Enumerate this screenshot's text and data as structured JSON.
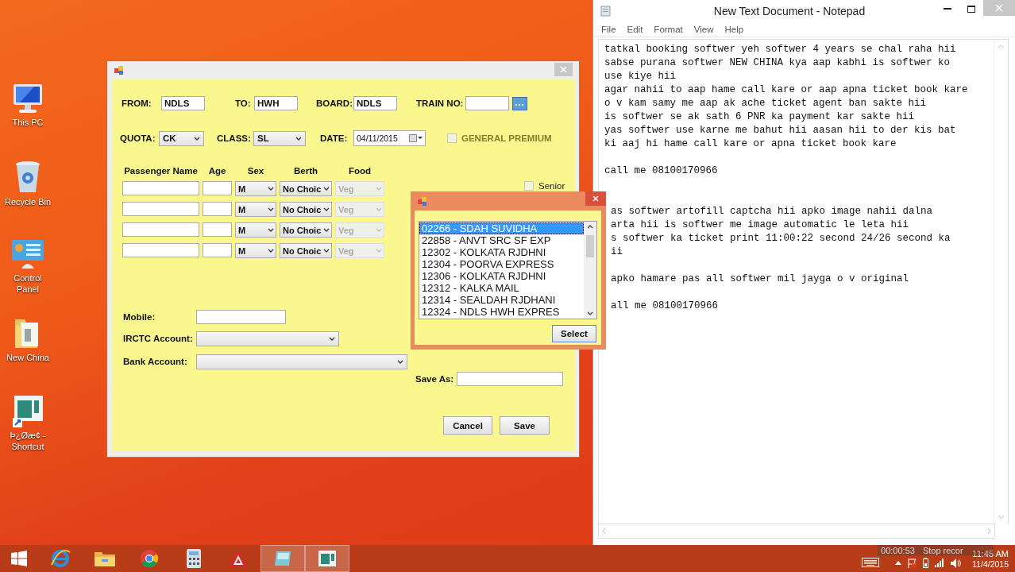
{
  "desktop_icons": [
    {
      "kind": "pc",
      "label": "This PC"
    },
    {
      "kind": "bin",
      "label": "Recycle Bin"
    },
    {
      "kind": "control",
      "label": "Control Panel"
    },
    {
      "kind": "folder",
      "label": "New China"
    },
    {
      "kind": "shortcut",
      "label": "Þ¿Øæ¢ - Shortcut"
    }
  ],
  "booking_form": {
    "route": [
      {
        "label": "FROM:",
        "value": "NDLS"
      },
      {
        "label": "TO:",
        "value": "HWH"
      },
      {
        "label": "BOARD:",
        "value": "NDLS"
      },
      {
        "label": "TRAIN NO:"
      }
    ],
    "quota": {
      "label": "QUOTA:",
      "value": "CK"
    },
    "class": {
      "label": "CLASS:",
      "value": "SL"
    },
    "date": {
      "label": "DATE:",
      "value": "04/11/2015"
    },
    "general_premium": {
      "label": "GENERAL PREMIUM",
      "checked": false
    },
    "passenger_columns": [
      "Passenger Name",
      "Age",
      "Sex",
      "Berth",
      "Food"
    ],
    "passengers": [
      {
        "sex": "M",
        "berth": "No Choic",
        "food": "Veg",
        "food_disabled": true
      },
      {
        "sex": "M",
        "berth": "No Choic",
        "food": "Veg",
        "food_disabled": true
      },
      {
        "sex": "M",
        "berth": "No Choic",
        "food": "Veg",
        "food_disabled": true
      },
      {
        "sex": "M",
        "berth": "No Choic",
        "food": "Veg",
        "food_disabled": true
      }
    ],
    "senior": {
      "label": "Senior",
      "checked": false
    },
    "mobile": {
      "label": "Mobile:"
    },
    "irctc_account": {
      "label": "IRCTC Account:"
    },
    "bank_account": {
      "label": "Bank Account:"
    },
    "save_as": {
      "label": "Save As:"
    },
    "buttons": [
      "Cancel",
      "Save"
    ]
  },
  "train_popup": {
    "trains": [
      {
        "label": "02266 - SDAH  SUVIDHA",
        "selected": true
      },
      {
        "label": "22858 - ANVT SRC SF EXP",
        "selected": false
      },
      {
        "label": "12302 - KOLKATA RJDHNI",
        "selected": false
      },
      {
        "label": "12304 - POORVA EXPRESS",
        "selected": false
      },
      {
        "label": "12306 - KOLKATA  RJDHNI",
        "selected": false
      },
      {
        "label": "12312 - KALKA MAIL",
        "selected": false
      },
      {
        "label": "12314 - SEALDAH RJDHANI",
        "selected": false
      },
      {
        "label": "12324 - NDLS HWH EXPRES",
        "selected": false
      }
    ],
    "button": "Select"
  },
  "notepad": {
    "title": "New Text Document - Notepad",
    "menu": [
      "File",
      "Edit",
      "Format",
      "View",
      "Help"
    ],
    "blocks": [
      {
        "lines": [
          "tatkal booking softwer yeh softwer 4 years se chal raha hii",
          "sabse purana softwer NEW CHINA kya aap kabhi is softwer ko",
          "use kiye hii",
          "agar nahii to aap hame call kare or aap apna ticket book kare",
          "o v kam samy me aap ak ache ticket agent ban sakte hii",
          "is softwer se ak sath 6 PNR ka payment kar sakte hii",
          "yas softwer use karne me bahut hii aasan hii to der kis bat",
          "ki aaj hi hame call kare or apna ticket book kare"
        ]
      },
      {
        "lines": [
          "call me 08100170966"
        ]
      },
      {
        "lines": [
          "as softwer artofill captcha hii apko image nahii dalna",
          "arta hii is softwer me image automatic le leta hii",
          "s softwer ka ticket print 11:00:22 second 24/26 second ka",
          "ii"
        ]
      },
      {
        "lines": [
          "apko hamare pas all softwer mil jayga o v original"
        ]
      },
      {
        "lines": [
          "all me 08100170966"
        ]
      }
    ]
  },
  "taskbar": {
    "apps": [
      {
        "kind": "ie",
        "open": false
      },
      {
        "kind": "explorer",
        "open": false
      },
      {
        "kind": "chrome",
        "open": false
      },
      {
        "kind": "calculator",
        "open": false
      },
      {
        "kind": "red-app",
        "open": false
      },
      {
        "kind": "notepad",
        "open": true
      },
      {
        "kind": "form-app",
        "open": true
      }
    ],
    "recorder_time": "00:00:53",
    "recorder_action": "Stop recor",
    "time": "11:45 AM",
    "date": "11/4/2015"
  }
}
